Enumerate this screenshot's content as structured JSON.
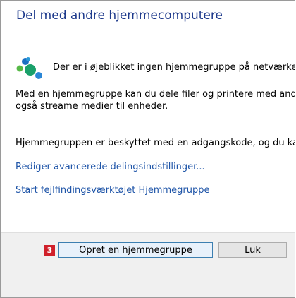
{
  "dialog": {
    "title": "Del med andre hjemmecomputere",
    "status": "Der er i øjeblikket ingen hjemmegruppe på netværket.",
    "paragraph1_line1": "Med en hjemmegruppe kan du dele filer og printere med andre computere på dit hjemmenetværk. Du kan",
    "paragraph1_line2": "også streame medier til enheder.",
    "paragraph2": "Hjemmegruppen er beskyttet med en adgangskode, og du kan altid vælge, hvad du deler.",
    "link_advanced": "Rediger avancerede delingsindstillinger...",
    "link_troubleshoot": "Start fejlfindingsværktøjet Hjemmegruppe"
  },
  "footer": {
    "step_badge": "3",
    "create_button": "Opret en hjemmegruppe",
    "close_button": "Luk"
  },
  "colors": {
    "title": "#1e3a8c",
    "link": "#1f55a8",
    "badge": "#d0202a",
    "footer_bg": "#f0f0f0"
  },
  "icons": {
    "homegroup": "homegroup-icon"
  }
}
